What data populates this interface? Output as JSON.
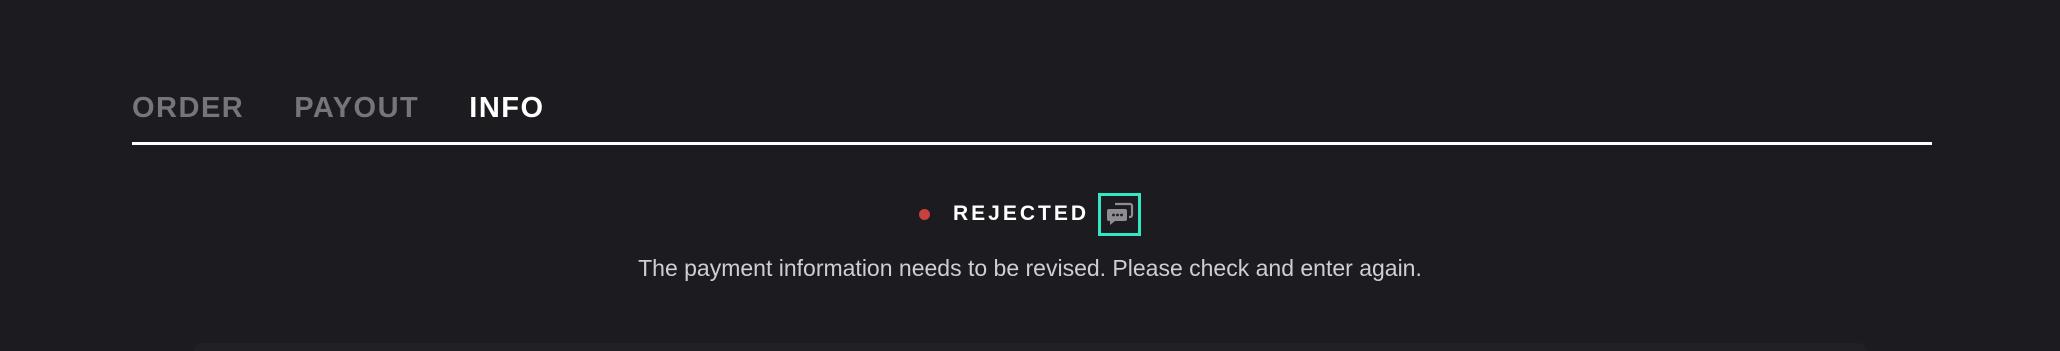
{
  "tabs": [
    {
      "label": "ORDER",
      "active": false
    },
    {
      "label": "PAYOUT",
      "active": false
    },
    {
      "label": "INFO",
      "active": true
    }
  ],
  "status": {
    "label": "REJECTED",
    "dot_color": "#c8413f",
    "chat_icon": "chat-bubbles-icon",
    "message": "The payment information needs to be revised. Please check and enter again."
  },
  "colors": {
    "background": "#1c1b20",
    "accent_border": "#33e6c4",
    "tab_inactive": "#76757b",
    "tab_active": "#ffffff"
  }
}
